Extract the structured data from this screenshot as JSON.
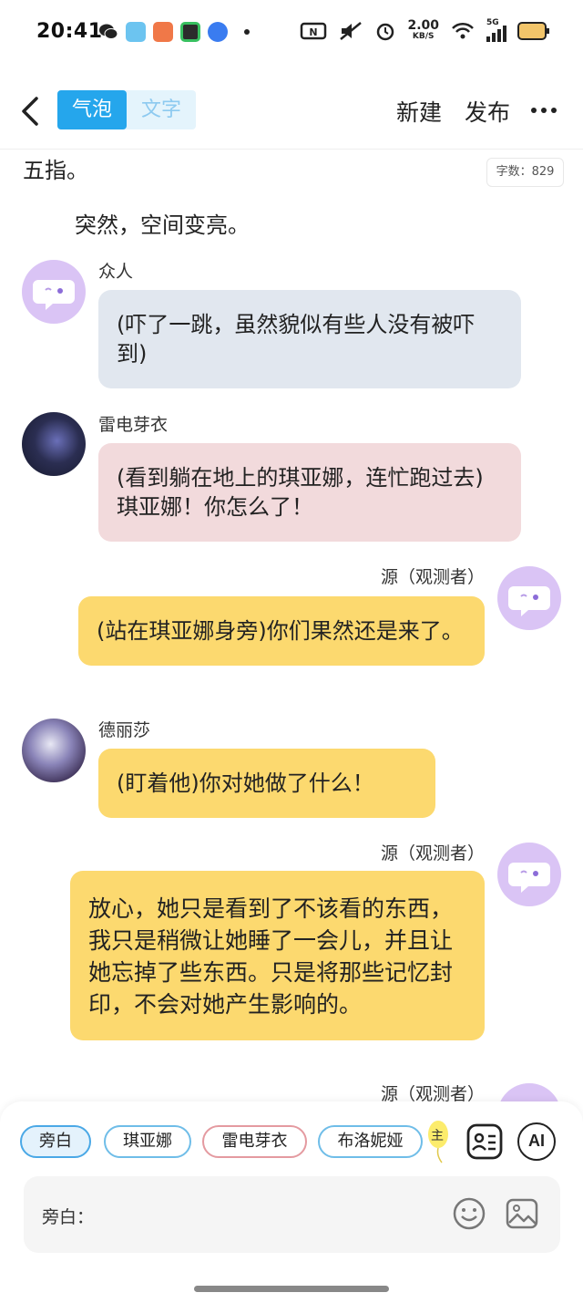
{
  "status_bar": {
    "time": "20:41",
    "net_speed_value": "2.00",
    "net_speed_unit": "KB/S",
    "network_type": "5G"
  },
  "nav": {
    "mode_bubble": "气泡",
    "mode_text": "文字",
    "new_label": "新建",
    "publish_label": "发布"
  },
  "chat": {
    "word_count": "字数：829",
    "narration_cut": "五指。",
    "narration_line": "突然，空间变亮。",
    "messages": [
      {
        "name": "众人",
        "text": "(吓了一跳，虽然貌似有些人没有被吓到)"
      },
      {
        "name": "雷电芽衣",
        "text": "(看到躺在地上的琪亚娜，连忙跑过去)琪亚娜！你怎么了！"
      },
      {
        "name": "源（观测者）",
        "text": "(站在琪亚娜身旁)你们果然还是来了。"
      },
      {
        "name": "德丽莎",
        "text": "(盯着他)你对她做了什么！"
      },
      {
        "name": "源（观测者）",
        "text": "放心，她只是看到了不该看的东西，我只是稍微让她睡了一会儿，并且让她忘掉了些东西。只是将那些记忆封印，不会对她产生影响的。"
      },
      {
        "name": "源（观测者）",
        "text": ""
      }
    ]
  },
  "bottom": {
    "roles": [
      "旁白",
      "琪亚娜",
      "雷电芽衣",
      "布洛妮娅"
    ],
    "peek_label": "主",
    "ai_label": "AI",
    "input_label": "旁白："
  },
  "colors": {
    "accent": "#25a6ec",
    "bubble_blue": "#e1e7ef",
    "bubble_pink": "#f2dadc",
    "bubble_yellow": "#fcd96f",
    "bot_avatar": "#dac4f5"
  },
  "icons": {
    "back": "chevron-left-icon",
    "more": "more-dots-icon",
    "card": "id-card-icon",
    "emoji": "smiley-icon",
    "image": "image-icon",
    "bot_avatar": "chat-bubble-face-icon"
  }
}
